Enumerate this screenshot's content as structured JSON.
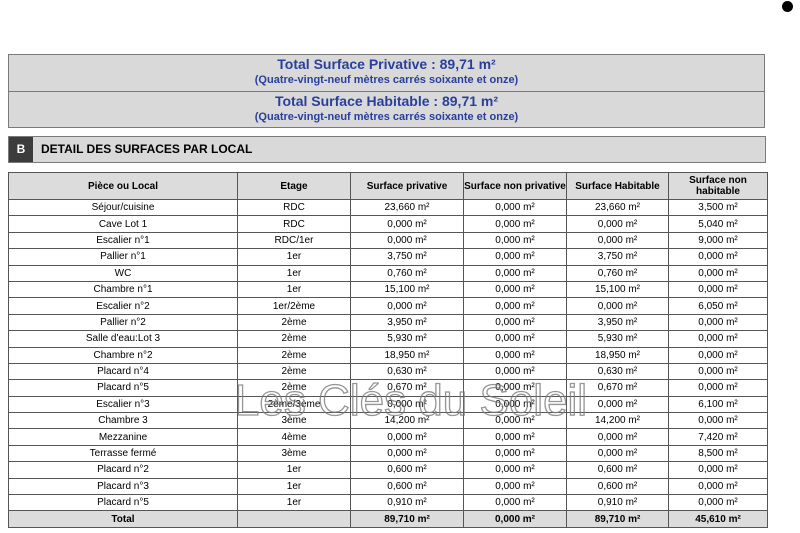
{
  "summary": {
    "privative_title": "Total Surface Privative : 89,71 m²",
    "privative_words": "(Quatre-vingt-neuf mètres carrés soixante et onze)",
    "habitable_title": "Total Surface Habitable : 89,71 m²",
    "habitable_words": "(Quatre-vingt-neuf mètres carrés soixante et onze)"
  },
  "section": {
    "letter": "B",
    "title": "DETAIL DES SURFACES PAR LOCAL"
  },
  "table": {
    "headers": {
      "piece": "Pièce ou Local",
      "etage": "Etage",
      "privative": "Surface privative",
      "non_privative": "Surface non privative",
      "habitable": "Surface Habitable",
      "non_habitable": "Surface non habitable"
    },
    "rows": [
      [
        "Séjour/cuisine",
        "RDC",
        "23,660 m²",
        "0,000 m²",
        "23,660 m²",
        "3,500 m²"
      ],
      [
        "Cave Lot 1",
        "RDC",
        "0,000 m²",
        "0,000 m²",
        "0,000 m²",
        "5,040 m²"
      ],
      [
        "Escalier n°1",
        "RDC/1er",
        "0,000 m²",
        "0,000 m²",
        "0,000 m²",
        "9,000 m²"
      ],
      [
        "Pallier n°1",
        "1er",
        "3,750 m²",
        "0,000 m²",
        "3,750 m²",
        "0,000 m²"
      ],
      [
        "WC",
        "1er",
        "0,760 m²",
        "0,000 m²",
        "0,760 m²",
        "0,000 m²"
      ],
      [
        "Chambre n°1",
        "1er",
        "15,100 m²",
        "0,000 m²",
        "15,100 m²",
        "0,000 m²"
      ],
      [
        "Escalier n°2",
        "1er/2ème",
        "0,000 m²",
        "0,000 m²",
        "0,000 m²",
        "6,050 m²"
      ],
      [
        "Pallier  n°2",
        "2ème",
        "3,950 m²",
        "0,000 m²",
        "3,950 m²",
        "0,000 m²"
      ],
      [
        "Salle d'eau:Lot 3",
        "2ème",
        "5,930 m²",
        "0,000 m²",
        "5,930 m²",
        "0,000 m²"
      ],
      [
        "Chambre n°2",
        "2ème",
        "18,950 m²",
        "0,000 m²",
        "18,950 m²",
        "0,000 m²"
      ],
      [
        "Placard n°4",
        "2ème",
        "0,630 m²",
        "0,000 m²",
        "0,630 m²",
        "0,000 m²"
      ],
      [
        "Placard n°5",
        "2ème",
        "0,670 m²",
        "0,000 m²",
        "0,670 m²",
        "0,000 m²"
      ],
      [
        "Escalier n°3",
        "2ème/3ème",
        "0,000 m²",
        "0,000 m²",
        "0,000 m²",
        "6,100 m²"
      ],
      [
        "Chambre 3",
        "3ème",
        "14,200 m²",
        "0,000 m²",
        "14,200 m²",
        "0,000 m²"
      ],
      [
        "Mezzanine",
        "4ème",
        "0,000 m²",
        "0,000 m²",
        "0,000 m²",
        "7,420 m²"
      ],
      [
        "Terrasse fermé",
        "3ème",
        "0,000 m²",
        "0,000 m²",
        "0,000 m²",
        "8,500 m²"
      ],
      [
        "Placard n°2",
        "1er",
        "0,600 m²",
        "0,000 m²",
        "0,600 m²",
        "0,000 m²"
      ],
      [
        "Placard n°3",
        "1er",
        "0,600 m²",
        "0,000 m²",
        "0,600 m²",
        "0,000 m²"
      ],
      [
        "Placard n°5",
        "1er",
        "0,910 m²",
        "0,000 m²",
        "0,910 m²",
        "0,000 m²"
      ]
    ],
    "total": [
      "Total",
      "",
      "89,710 m²",
      "0,000 m²",
      "89,710 m²",
      "45,610 m²"
    ]
  },
  "watermark": {
    "text": "Les Clés du Soleil"
  }
}
